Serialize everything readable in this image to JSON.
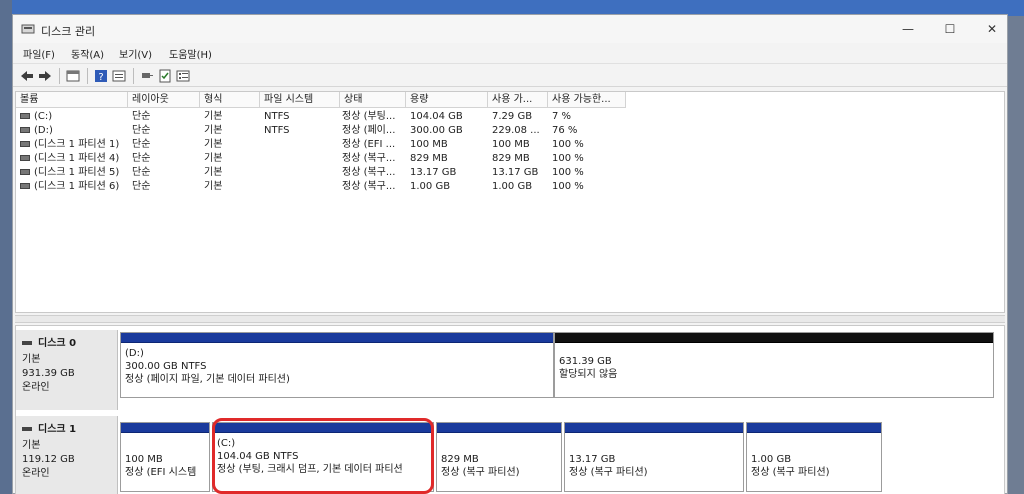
{
  "window": {
    "title": "디스크 관리"
  },
  "menu": [
    "파일(F)",
    "동작(A)",
    "보기(V)",
    "도움말(H)"
  ],
  "toolbar_icons": [
    "back-arrow-icon",
    "forward-arrow-icon",
    "view-pane-icon",
    "help-icon",
    "properties-icon",
    "connect-icon",
    "check-icon",
    "list-icon"
  ],
  "volume_table": {
    "columns": [
      "볼륨",
      "레이아웃",
      "형식",
      "파일 시스템",
      "상태",
      "용량",
      "사용 가...",
      "사용 가능한..."
    ],
    "rows": [
      [
        "(C:)",
        "단순",
        "기본",
        "NTFS",
        "정상 (부팅...",
        "104.04 GB",
        "7.29 GB",
        "7 %"
      ],
      [
        "(D:)",
        "단순",
        "기본",
        "NTFS",
        "정상 (페이...",
        "300.00 GB",
        "229.08 ...",
        "76 %"
      ],
      [
        "(디스크 1 파티션 1)",
        "단순",
        "기본",
        "",
        "정상 (EFI ...",
        "100 MB",
        "100 MB",
        "100 %"
      ],
      [
        "(디스크 1 파티션 4)",
        "단순",
        "기본",
        "",
        "정상 (복구...",
        "829 MB",
        "829 MB",
        "100 %"
      ],
      [
        "(디스크 1 파티션 5)",
        "단순",
        "기본",
        "",
        "정상 (복구...",
        "13.17 GB",
        "13.17 GB",
        "100 %"
      ],
      [
        "(디스크 1 파티션 6)",
        "단순",
        "기본",
        "",
        "정상 (복구...",
        "1.00 GB",
        "1.00 GB",
        "100 %"
      ]
    ]
  },
  "disks": [
    {
      "name": "디스크 0",
      "type": "기본",
      "size": "931.39 GB",
      "status": "온라인",
      "partitions": [
        {
          "name": "(D:)",
          "size": "300.00 GB NTFS",
          "status": "정상 (페이지 파일, 기본 데이터 파티션)",
          "unallocated": false
        },
        {
          "name": "",
          "size": "631.39 GB",
          "status": "할당되지 않음",
          "unallocated": true
        }
      ]
    },
    {
      "name": "디스크 1",
      "type": "기본",
      "size": "119.12 GB",
      "status": "온라인",
      "partitions": [
        {
          "name": "",
          "size": "100 MB",
          "status": "정상 (EFI 시스템",
          "unallocated": false
        },
        {
          "name": "(C:)",
          "size": "104.04 GB NTFS",
          "status": "정상 (부팅, 크래시 덤프, 기본 데이터 파티션",
          "unallocated": false
        },
        {
          "name": "",
          "size": "829 MB",
          "status": "정상 (복구 파티션)",
          "unallocated": false
        },
        {
          "name": "",
          "size": "13.17 GB",
          "status": "정상 (복구 파티션)",
          "unallocated": false
        },
        {
          "name": "",
          "size": "1.00 GB",
          "status": "정상 (복구 파티션)",
          "unallocated": false
        }
      ]
    }
  ],
  "colors": {
    "primary_partition": "#1a3a9c",
    "unallocated": "#111111",
    "annotation": "#e02a2a"
  }
}
